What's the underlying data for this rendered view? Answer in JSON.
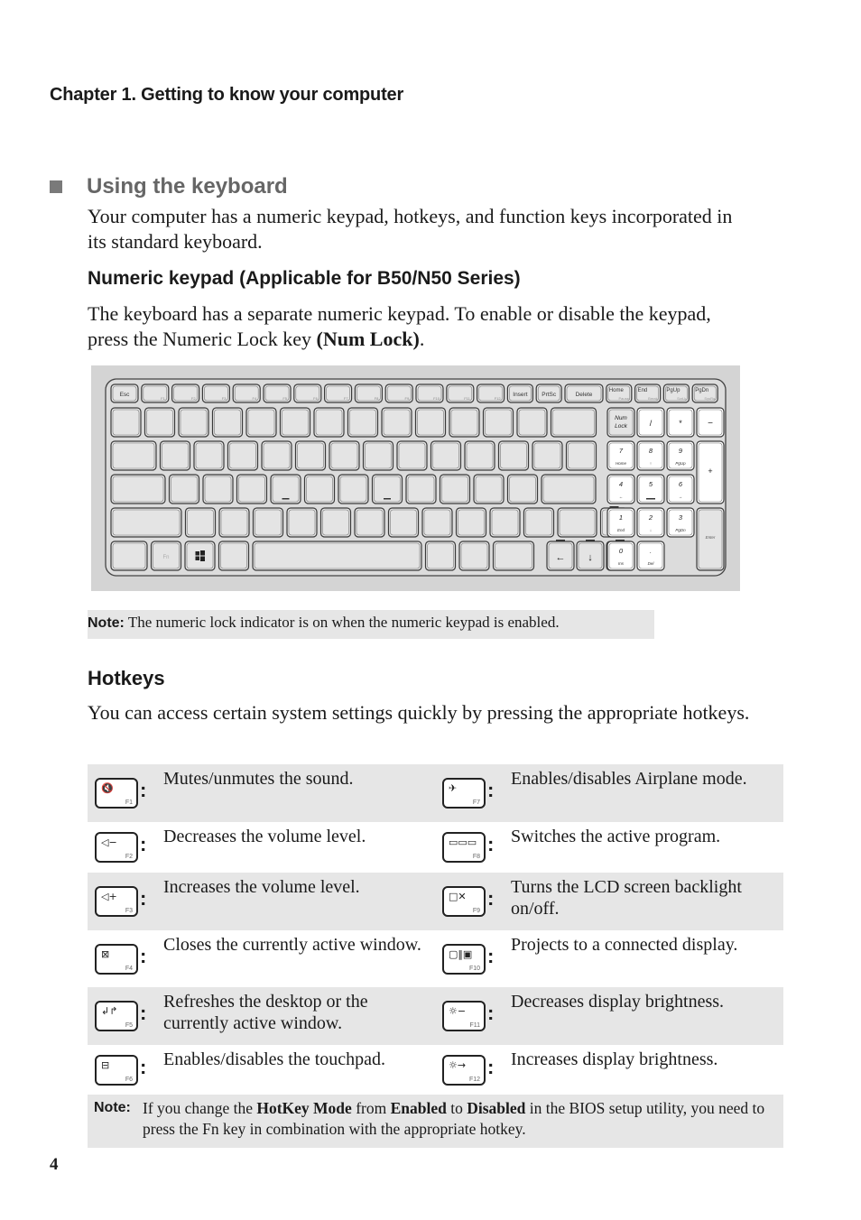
{
  "header": {
    "chapter": "Chapter 1. Getting to know your computer"
  },
  "section": {
    "title": "Using the keyboard",
    "intro": "Your computer has a numeric keypad, hotkeys, and function keys incorporated in its standard keyboard."
  },
  "numeric_keypad": {
    "heading": "Numeric keypad (Applicable for B50/N50 Series)",
    "text_before": "The keyboard has a separate numeric keypad. To enable or disable the keypad, press the Numeric Lock key ",
    "text_bold": "(Num Lock)",
    "text_after": "."
  },
  "keyboard_figure": {
    "top_row": [
      "Esc",
      "F1",
      "F2",
      "F3",
      "F4",
      "F5",
      "F6",
      "F7",
      "F8",
      "F9",
      "F10",
      "F11",
      "F12",
      "Insert",
      "PrtSc",
      "Delete",
      "Home",
      "End",
      "PgUp",
      "PgDn"
    ],
    "top_row_secondary": {
      "Home": "Pause",
      "End": "Break",
      "PgUp": "ScrLk",
      "PgDn": "SysRq"
    },
    "numpad": {
      "num_lock": "Num Lock",
      "divide": "/",
      "multiply": "*",
      "minus": "−",
      "plus": "+",
      "enter": "Enter",
      "keys": [
        {
          "main": "7",
          "sub": "Home"
        },
        {
          "main": "8",
          "sub": "↑"
        },
        {
          "main": "9",
          "sub": "PgUp"
        },
        {
          "main": "4",
          "sub": "←"
        },
        {
          "main": "5",
          "sub": ""
        },
        {
          "main": "6",
          "sub": "→"
        },
        {
          "main": "1",
          "sub": "End"
        },
        {
          "main": "2",
          "sub": "↓"
        },
        {
          "main": "3",
          "sub": "PgDn"
        },
        {
          "main": "0",
          "sub": "Ins"
        },
        {
          "main": ".",
          "sub": "Del"
        }
      ]
    },
    "fn_label": "Fn"
  },
  "note1": {
    "label": "Note:",
    "text": "The numeric lock indicator is on when the numeric keypad is enabled."
  },
  "hotkeys": {
    "heading": "Hotkeys",
    "text": "You can access certain system settings quickly by pressing the appropriate hotkeys.",
    "rows": [
      {
        "left": {
          "key": "F1",
          "icon": "mute-icon",
          "glyph": "🔇",
          "desc": "Mutes/unmutes the sound."
        },
        "right": {
          "key": "F7",
          "icon": "airplane-icon",
          "glyph": "✈",
          "desc": "Enables/disables Airplane mode."
        }
      },
      {
        "left": {
          "key": "F2",
          "icon": "volume-down-icon",
          "glyph": "◁−",
          "desc": "Decreases the volume level."
        },
        "right": {
          "key": "F8",
          "icon": "switch-program-icon",
          "glyph": "▭▭▭",
          "desc": "Switches the active program."
        }
      },
      {
        "left": {
          "key": "F3",
          "icon": "volume-up-icon",
          "glyph": "◁+",
          "desc": "Increases the volume level."
        },
        "right": {
          "key": "F9",
          "icon": "backlight-off-icon",
          "glyph": "□✕",
          "desc": "Turns the LCD screen backlight on/off."
        }
      },
      {
        "left": {
          "key": "F4",
          "icon": "close-window-icon",
          "glyph": "⊠",
          "desc": "Closes the currently active window."
        },
        "right": {
          "key": "F10",
          "icon": "project-display-icon",
          "glyph": "▢‖▣",
          "desc": "Projects to a connected display."
        }
      },
      {
        "left": {
          "key": "F5",
          "icon": "refresh-icon",
          "glyph": "↲↱",
          "desc": "Refreshes the desktop or the currently active window."
        },
        "right": {
          "key": "F11",
          "icon": "brightness-down-icon",
          "glyph": "☼−",
          "desc": "Decreases display brightness."
        }
      },
      {
        "left": {
          "key": "F6",
          "icon": "touchpad-icon",
          "glyph": "⊟",
          "desc": "Enables/disables the touchpad."
        },
        "right": {
          "key": "F12",
          "icon": "brightness-up-icon",
          "glyph": "☼→",
          "desc": "Increases display brightness."
        }
      }
    ]
  },
  "note2": {
    "label": "Note:",
    "parts": [
      {
        "t": "If you change the ",
        "b": false
      },
      {
        "t": "HotKey Mode",
        "b": true
      },
      {
        "t": " from ",
        "b": false
      },
      {
        "t": "Enabled",
        "b": true
      },
      {
        "t": " to ",
        "b": false
      },
      {
        "t": "Disabled",
        "b": true
      },
      {
        "t": " in the BIOS setup utility, you need to press the Fn key in combination with the appropriate hotkey.",
        "b": false
      }
    ]
  },
  "page_number": "4"
}
